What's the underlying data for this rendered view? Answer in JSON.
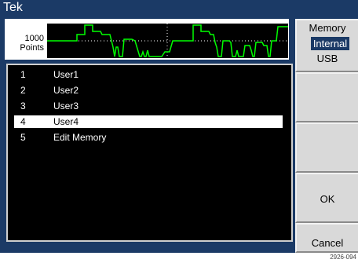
{
  "title": "Tek",
  "waveform": {
    "points_value": "1000",
    "points_label": "Points"
  },
  "memory_list": [
    {
      "num": "1",
      "label": "User1",
      "selected": false
    },
    {
      "num": "2",
      "label": "User2",
      "selected": false
    },
    {
      "num": "3",
      "label": "User3",
      "selected": false
    },
    {
      "num": "4",
      "label": "User4",
      "selected": true
    },
    {
      "num": "5",
      "label": "Edit Memory",
      "selected": false
    }
  ],
  "softkeys": {
    "memory": {
      "title": "Memory",
      "options": [
        "Internal",
        "USB"
      ],
      "selected": "Internal"
    },
    "ok": "OK",
    "cancel": "Cancel"
  },
  "footnote": "2926-094",
  "colors": {
    "frame": "#1b3a66",
    "waveform": "#00ff00",
    "softkey_bg": "#d9d9d9"
  }
}
